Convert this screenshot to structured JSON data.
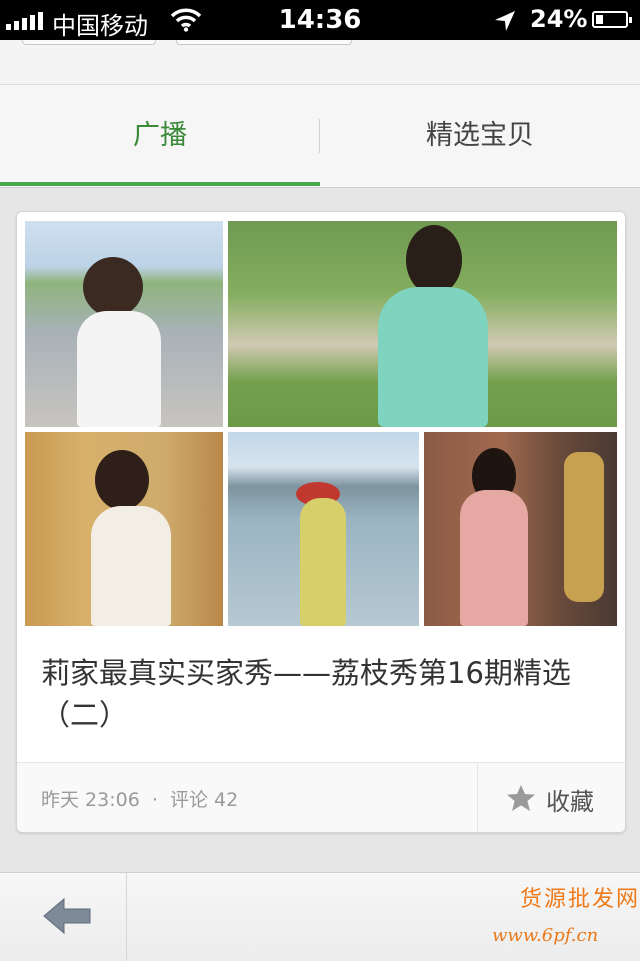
{
  "status_bar": {
    "carrier": "中国移动",
    "time": "14:36",
    "battery": "24%"
  },
  "tabs": [
    {
      "label": "广播",
      "active": true
    },
    {
      "label": "精选宝贝",
      "active": false
    }
  ],
  "post": {
    "title": "莉家最真实买家秀——荔枝秀第16期精选（二）",
    "time": "昨天 23:06",
    "separator": "·",
    "comments": "评论 42",
    "favorite_label": "收藏"
  },
  "watermark": {
    "brand": "货源批发网",
    "url": "www.6pf.cn"
  },
  "colors": {
    "accent": "#4aa84a",
    "active_tab_text": "#3a8a3a",
    "watermark": "#f07a1a"
  },
  "icons": [
    "signal-icon",
    "wifi-icon",
    "location-icon",
    "battery-icon",
    "star-icon",
    "back-arrow-icon"
  ]
}
